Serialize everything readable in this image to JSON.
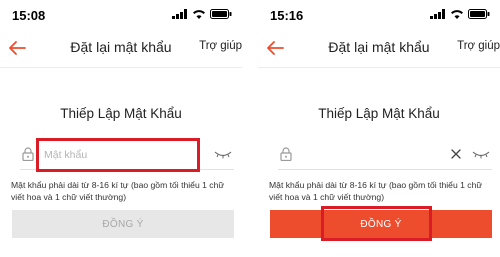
{
  "colors": {
    "accent": "#ee4d2d",
    "highlight": "#d91c26",
    "button_disabled_bg": "#e7e7e7",
    "button_disabled_text": "#a8a8a8"
  },
  "screens": [
    {
      "status_time": "15:08",
      "nav": {
        "title": "Đặt lại mật khẩu",
        "help_label": "Trợ giúp",
        "back_icon": "arrow-left-icon"
      },
      "section_title": "Thiếp Lập Mật Khẩu",
      "password_input": {
        "placeholder": "Mật khẩu",
        "value": "",
        "show_clear": false
      },
      "hint": "Mật khẩu phải dài từ 8-16 kí tự (bao gồm tối thiểu 1 chữ viết hoa và 1 chữ viết thường)",
      "confirm_button": {
        "label": "ĐỒNG Ý",
        "state": "disabled"
      },
      "highlighted": "password-input"
    },
    {
      "status_time": "15:16",
      "nav": {
        "title": "Đặt lại mật khẩu",
        "help_label": "Trợ giúp",
        "back_icon": "arrow-left-icon"
      },
      "section_title": "Thiếp Lập Mật Khẩu",
      "password_input": {
        "placeholder": "",
        "value": "",
        "show_clear": true
      },
      "hint": "Mật khẩu phải dài từ 8-16 kí tự (bao gồm tối thiểu 1 chữ viết hoa và 1 chữ viết thường)",
      "confirm_button": {
        "label": "ĐỒNG Ý",
        "state": "enabled"
      },
      "highlighted": "confirm-button"
    }
  ]
}
